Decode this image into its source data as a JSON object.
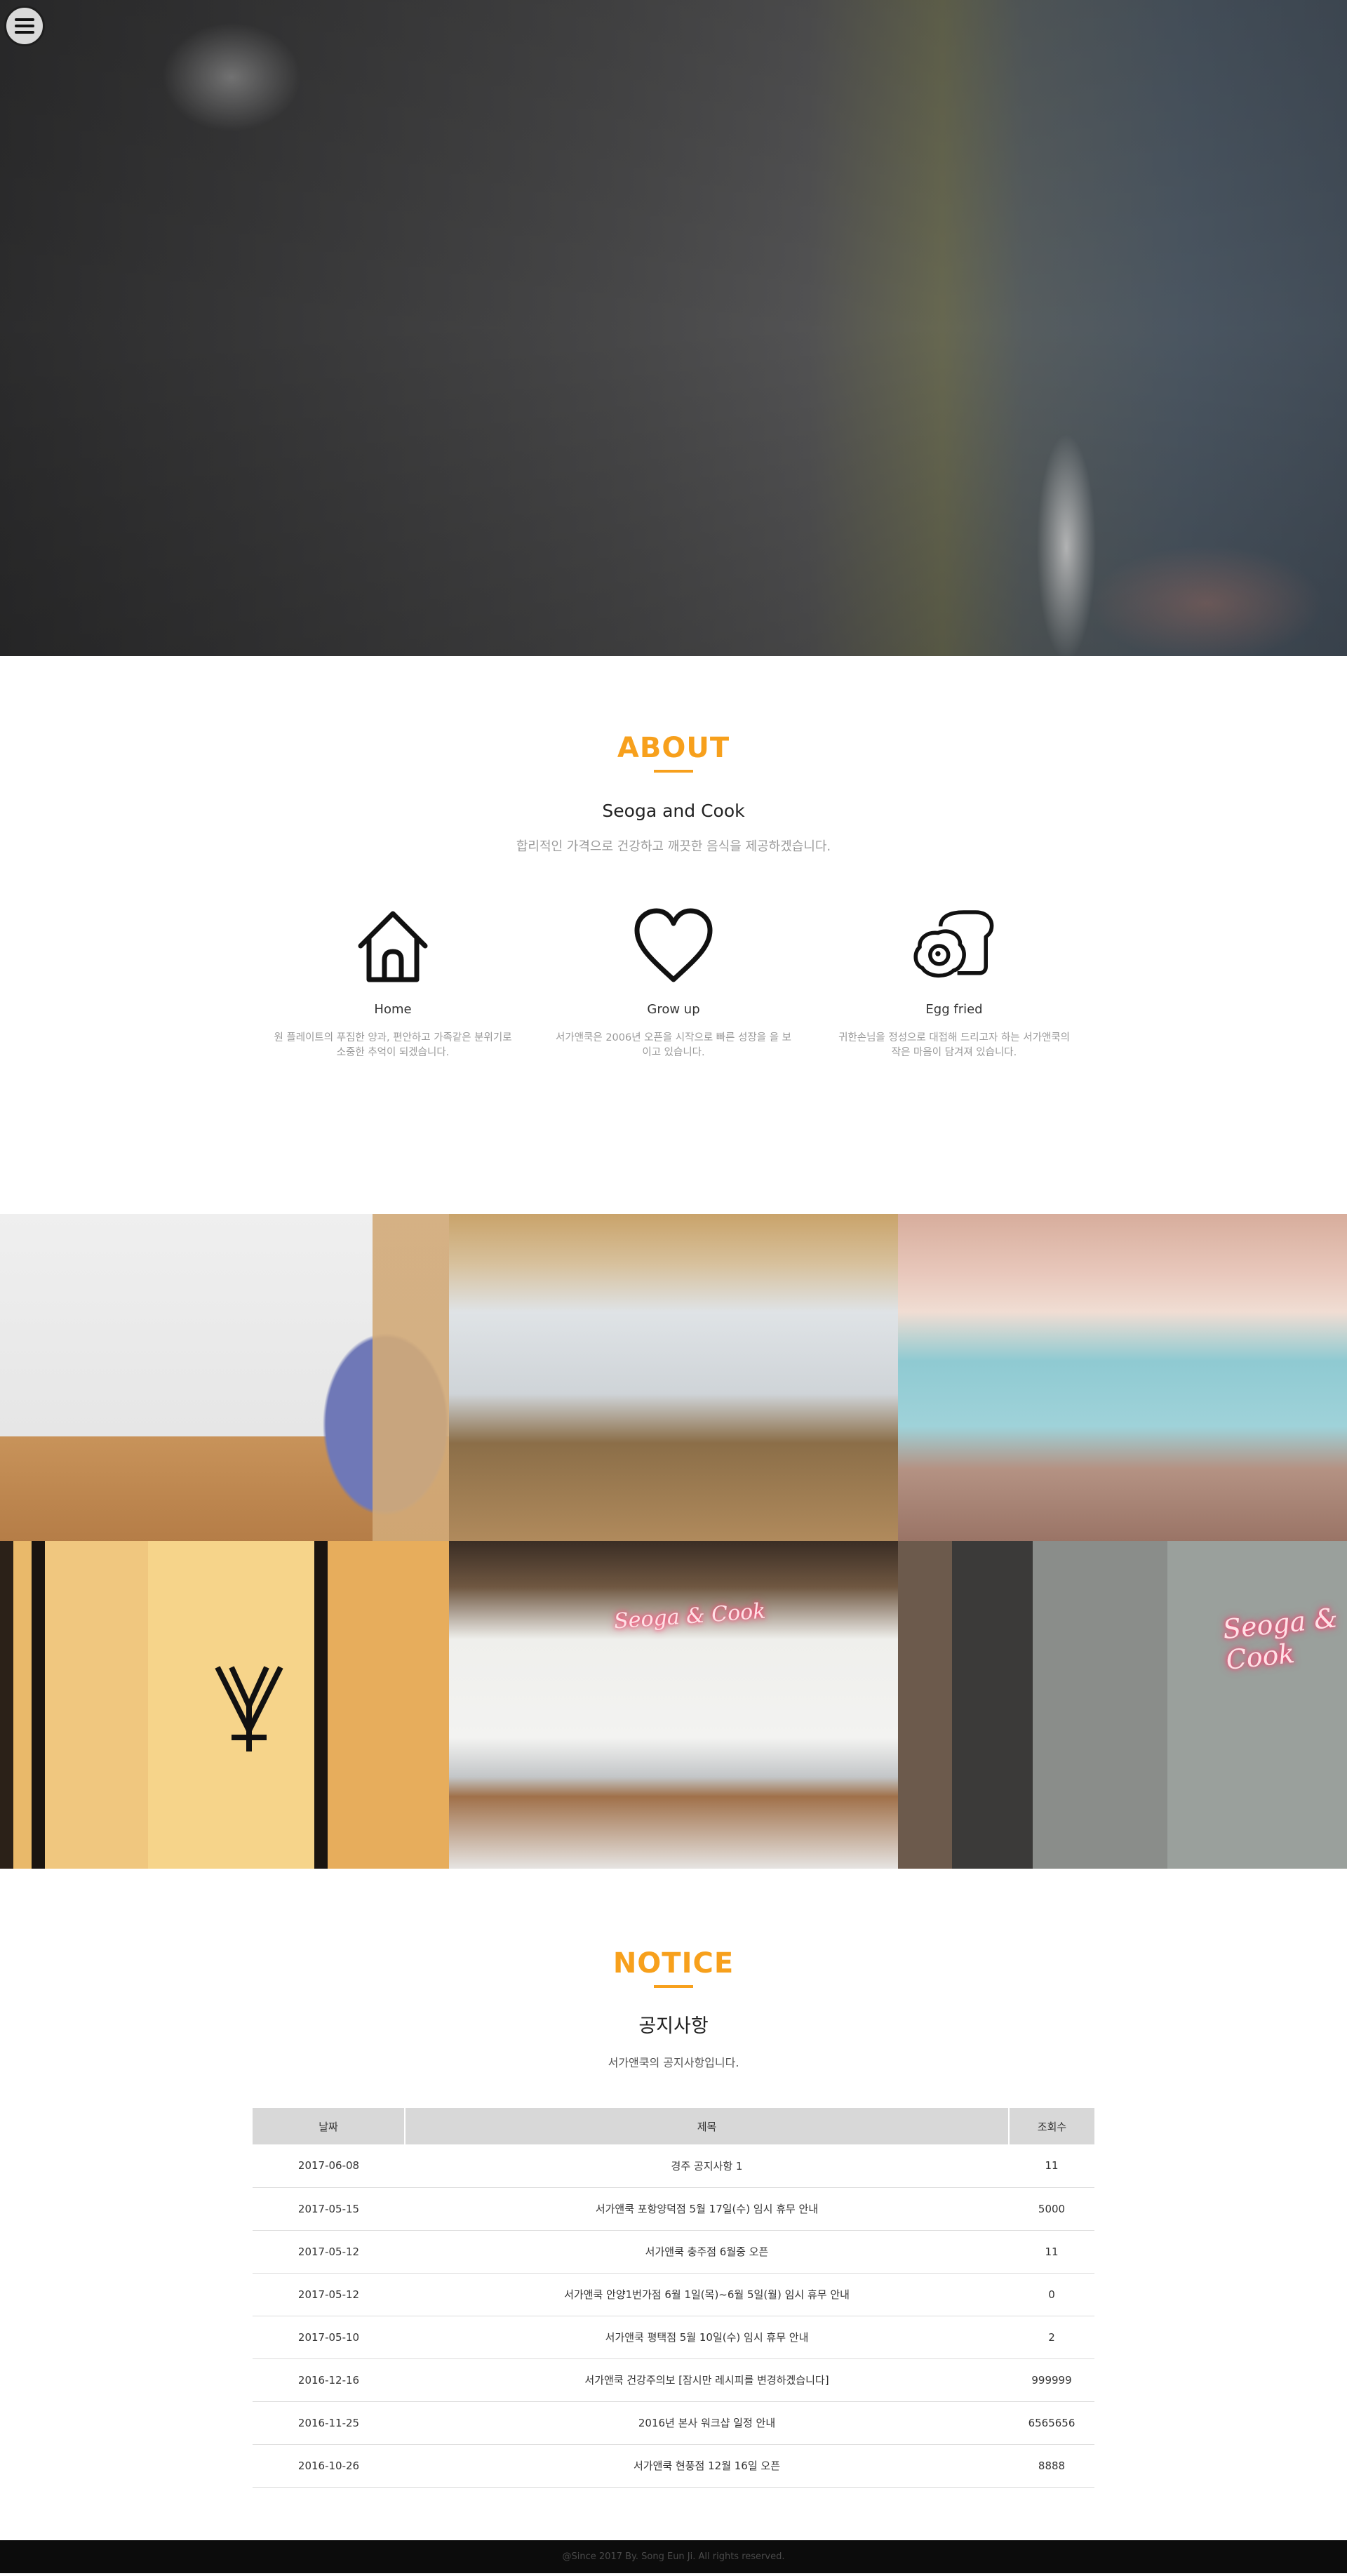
{
  "about": {
    "heading": "ABOUT",
    "subtitle": "Seoga and Cook",
    "description": "합리적인 가격으로 건강하고 깨끗한 음식을 제공하겠습니다.",
    "features": [
      {
        "icon": "home-icon",
        "title": "Home",
        "text": "원 플레이트의 푸짐한 양과, 편안하고 가족같은 분위기로 소중한 추억이 되겠습니다."
      },
      {
        "icon": "heart-icon",
        "title": "Grow up",
        "text": "서가앤쿡은 2006년 오픈을 시작으로 빠른 성장을 을 보이고 있습니다."
      },
      {
        "icon": "egg-fried-icon",
        "title": "Egg fried",
        "text": "귀한손님을 정성으로 대접해 드리고자 하는 서가앤쿡의 작은 마음이 담겨져 있습니다."
      }
    ]
  },
  "gallery": {
    "neon_sign": "Seoga & Cook"
  },
  "notice": {
    "heading": "NOTICE",
    "subtitle": "공지사항",
    "description": "서가앤쿡의 공지사항입니다.",
    "columns": [
      "날짜",
      "제목",
      "조회수"
    ],
    "rows": [
      {
        "date": "2017-06-08",
        "title": "경주 공지사항 1",
        "views": "11"
      },
      {
        "date": "2017-05-15",
        "title": "서가앤쿡 포항양덕점 5월 17일(수) 임시 휴무 안내",
        "views": "5000"
      },
      {
        "date": "2017-05-12",
        "title": "서가앤쿡 충주점 6월중 오픈",
        "views": "11"
      },
      {
        "date": "2017-05-12",
        "title": "서가앤쿡 안양1번가점 6월 1일(목)~6월 5일(월) 임시 휴무 안내",
        "views": "0"
      },
      {
        "date": "2017-05-10",
        "title": "서가앤쿡 평택점 5월 10일(수) 임시 휴무 안내",
        "views": "2"
      },
      {
        "date": "2016-12-16",
        "title": "서가앤쿡 건강주의보 [잠시만 레시피를 변경하겠습니다]",
        "views": "999999"
      },
      {
        "date": "2016-11-25",
        "title": "2016년 본사 워크샵 일정 안내",
        "views": "6565656"
      },
      {
        "date": "2016-10-26",
        "title": "서가앤쿡 현풍점 12월 16일 오픈",
        "views": "8888"
      }
    ]
  },
  "footer": {
    "copyright": "@Since 2017 By. Song Eun Ji. All rights reserved."
  },
  "colors": {
    "accent": "#f7a01c",
    "footer_bg": "#0c0c0c"
  }
}
